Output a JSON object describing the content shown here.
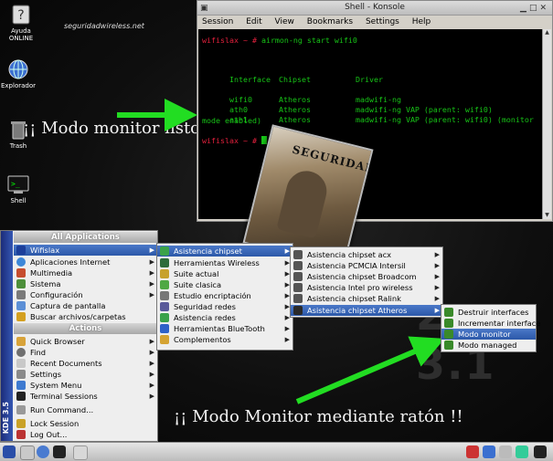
{
  "desktop": {
    "watermark": "seguridadwireless.net",
    "icons": [
      {
        "label": "Ayuda ONLINE",
        "icon": "help-book-icon"
      },
      {
        "label": "Explorador",
        "icon": "explorer-globe-icon"
      },
      {
        "label": "Trash",
        "icon": "trash-icon"
      },
      {
        "label": "Shell",
        "icon": "shell-terminal-icon"
      }
    ],
    "caption_top": "¡¡ Modo monitor listo !!",
    "caption_bottom": "¡¡ Modo Monitor mediante ratón !!",
    "bg_logo": "2x 3.1",
    "photo_text": "SEGURIDAD"
  },
  "konsole": {
    "title": "Shell - Konsole",
    "menu": [
      "Session",
      "Edit",
      "View",
      "Bookmarks",
      "Settings",
      "Help"
    ],
    "prompt1": "wifislax ~ #",
    "command": " airmon-ng start wifi0",
    "headers": [
      "Interface",
      "Chipset",
      "Driver"
    ],
    "rows": [
      [
        "wifi0",
        "Atheros",
        "madwifi-ng"
      ],
      [
        "ath0",
        "Atheros",
        "madwifi-ng VAP (parent: wifi0)"
      ],
      [
        "ath1",
        "Atheros",
        "madwifi-ng VAP (parent: wifi0) (monitor"
      ]
    ],
    "wrap_line": "mode enabled)",
    "prompt2": "wifislax ~ #"
  },
  "kmenu": {
    "side_label": "KDE 3.5",
    "section_apps": "All Applications",
    "section_actions": "Actions",
    "apps": [
      "Wifislax",
      "Aplicaciones Internet",
      "Multimedia",
      "Sistema",
      "Configuración",
      "Captura de pantalla",
      "Buscar archivos/carpetas"
    ],
    "actions": [
      "Quick Browser",
      "Find",
      "Recent Documents",
      "Settings",
      "System Menu",
      "Terminal Sessions",
      "Run Command...",
      "Lock Session",
      "Log Out..."
    ]
  },
  "wifislax_menu": [
    "Asistencia chipset",
    "Herramientas Wireless",
    "Suite actual",
    "Suite clasica",
    "Estudio encriptación",
    "Seguridad redes",
    "Asistencia redes",
    "Herramientas BlueTooth",
    "Complementos"
  ],
  "chipset_menu": [
    "Asistencia chipset acx",
    "Asistencia PCMCIA Intersil",
    "Asistencia chipset Broadcom",
    "Asistencia Intel pro wireless",
    "Asistencia chipset Ralink",
    "Asistencia chipset Atheros"
  ],
  "atheros_menu": [
    "Destruir interfaces",
    "Incrementar interface",
    "Modo monitor",
    "Modo managed"
  ],
  "colors": {
    "arrow": "#22dd22",
    "selection": "#3a68b8",
    "terminal_text": "#17c417",
    "prompt": "#e0203c"
  }
}
